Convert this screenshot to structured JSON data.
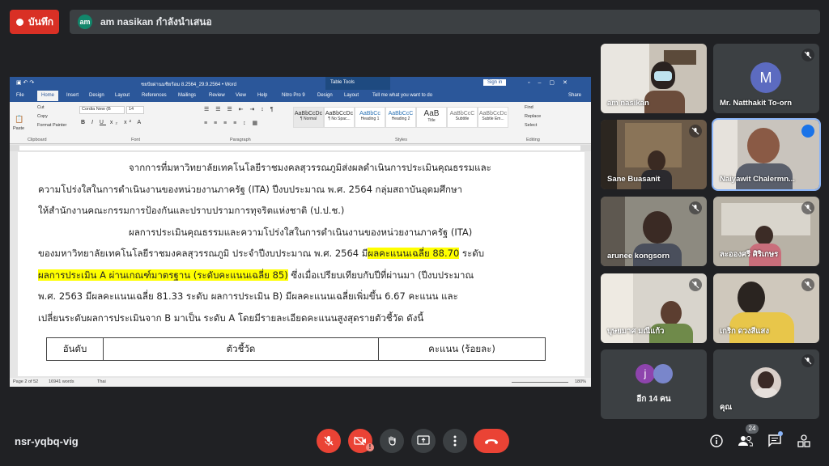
{
  "top": {
    "record_label": "บันทึก",
    "presenter_initials": "am",
    "presenter_text": "am nasikan กำลังนำเสนอ"
  },
  "word": {
    "doc_title": "ชยปัยผ่านมชิยร้อม 8.2564_29.9.2564 • Word",
    "table_tools": "Table Tools",
    "sign_in": "Sign in",
    "tabs": [
      "File",
      "Home",
      "Insert",
      "Design",
      "Layout",
      "References",
      "Mailings",
      "Review",
      "View",
      "Help",
      "Nitro Pro 9",
      "Design",
      "Layout"
    ],
    "tell_me": "Tell me what you want to do",
    "share": "Share",
    "clipboard": {
      "paste": "Paste",
      "cut": "Cut",
      "copy": "Copy",
      "format_painter": "Format Painter",
      "group": "Clipboard"
    },
    "font": {
      "name": "Cordia New (B",
      "size": "14",
      "group": "Font"
    },
    "paragraph_group": "Paragraph",
    "styles": [
      {
        "preview": "AaBbCcDc",
        "name": "¶ Normal"
      },
      {
        "preview": "AaBbCcDc",
        "name": "¶ No Spac..."
      },
      {
        "preview": "AaBbCc",
        "name": "Heading 1"
      },
      {
        "preview": "AaBbCcC",
        "name": "Heading 2"
      },
      {
        "preview": "AaB",
        "name": "Title"
      },
      {
        "preview": "AaBbCcC",
        "name": "Subtitle"
      },
      {
        "preview": "AaBbCcDc",
        "name": "Subtle Em..."
      }
    ],
    "styles_group": "Styles",
    "editing": {
      "find": "Find",
      "replace": "Replace",
      "select": "Select",
      "group": "Editing"
    },
    "doc_lines": [
      "จากการที่มหาวิทยาลัยเทคโนโลยีราชมงคลสุวรรณภูมิส่งผลดำเนินการประเมินคุณธรรมและ",
      "ความโปร่งใสในการดำเนินงานของหน่วยงานภาครัฐ (ITA) ปีงบประมาณ พ.ศ. 2564 กลุ่มสถาบันอุดมศึกษา",
      "ให้สำนักงานคณะกรรมการป้องกันและปราบปรามการทุจริตแห่งชาติ (ป.ป.ช.)",
      "ผลการประเมินคุณธรรมและความโปร่งใสในการดำเนินงานของหน่วยงานภาครัฐ (ITA)"
    ],
    "line5_pre": "ของมหาวิทยาลัยเทคโนโลยีราชมงคลสุวรรณภูมิ ประจำปีงบประมาณ พ.ศ. 2564 มี",
    "line5_hl": "ผลคะแนนเฉลี่ย 88.70",
    "line5_post": " ระดับ",
    "line6_hl": "ผลการประเมิน A ผ่านเกณฑ์มาตรฐาน (ระดับคะแนนเฉลี่ย 85)",
    "line6_post": " ซึ่งเมื่อเปรียบเทียบกับปีที่ผ่านมา (ปีงบประมาณ",
    "line7": "พ.ศ. 2563 มีผลคะแนนเฉลี่ย 81.33 ระดับ ผลการประเมิน B) มีผลคะแนนเฉลี่ยเพิ่มขึ้น 6.67 คะแนน และ",
    "line8": "เปลี่ยนระดับผลการประเมินจาก B มาเป็น ระดับ A โดยมีรายละเอียดคะแนนสูงสุดรายตัวชี้วัด ดังนี้",
    "table_headers": [
      "อันดับ",
      "ตัวชี้วัด",
      "คะแนน (ร้อยละ)"
    ],
    "status": {
      "page": "Page 2 of 52",
      "words": "16941 words",
      "lang": "Thai",
      "zoom": "180%"
    }
  },
  "participants": [
    {
      "name": "am nasikan",
      "muted": false
    },
    {
      "name": "Mr. Natthakit To-orn",
      "initial": "M",
      "muted": true
    },
    {
      "name": "Sane Buasanit",
      "muted": true
    },
    {
      "name": "Naiyawit Chalermn...",
      "muted": false,
      "speaking": true
    },
    {
      "name": "arunee kongsorn",
      "muted": true
    },
    {
      "name": "ละอองศรี ศิริเกษร",
      "muted": true
    },
    {
      "name": "บุษยมาศ มณีแก้ว",
      "muted": true
    },
    {
      "name": "เกริก ดวงสีแสง",
      "muted": true
    },
    {
      "name": "อีก 14 คน",
      "initial": "j",
      "muted": false
    },
    {
      "name": "คุณ",
      "muted": true
    }
  ],
  "bottom": {
    "meeting_code": "nsr-yqbq-vig",
    "people_count": "24"
  }
}
